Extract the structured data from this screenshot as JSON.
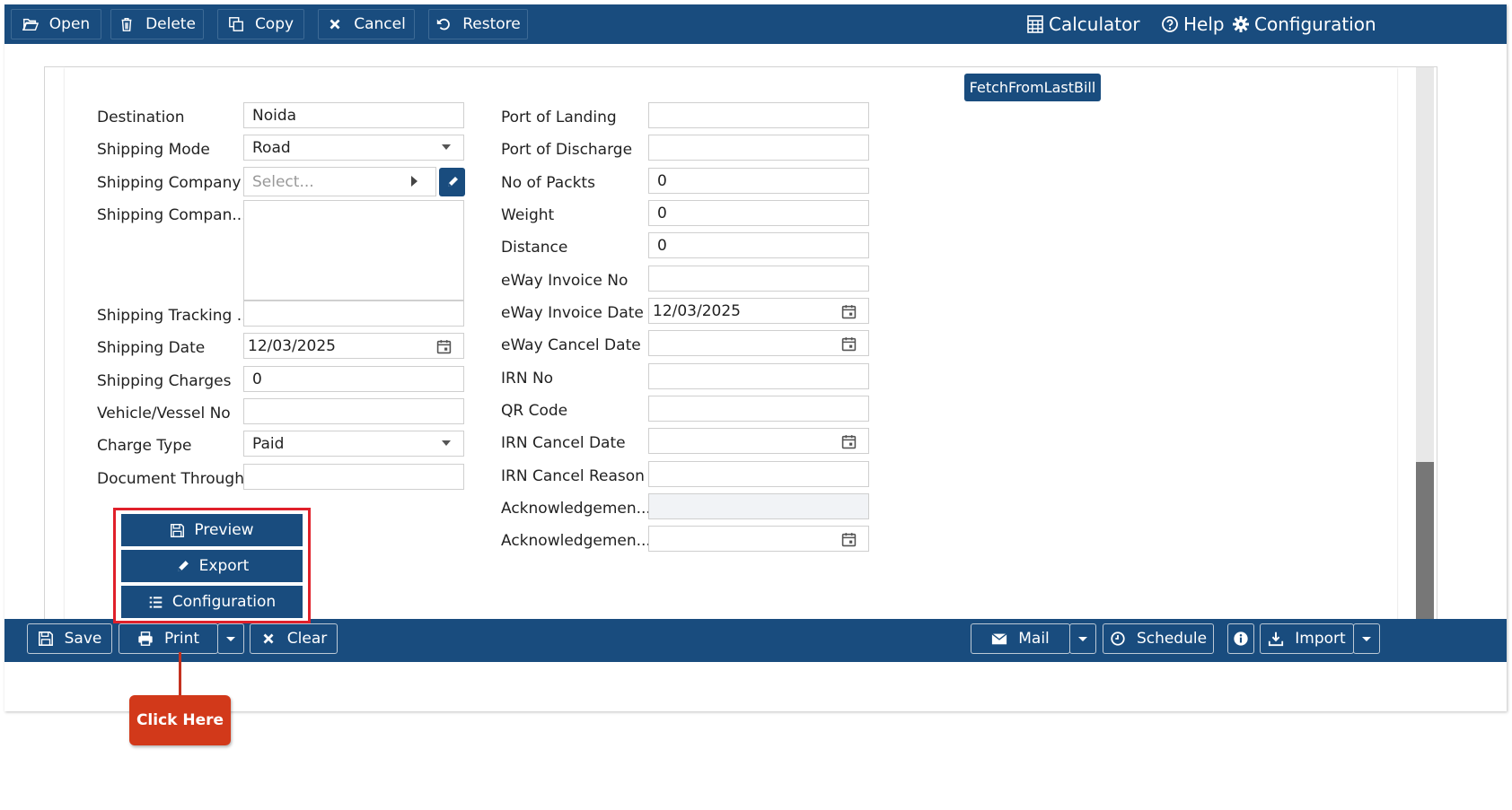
{
  "toolbar": {
    "open": "Open",
    "delete": "Delete",
    "copy": "Copy",
    "cancel": "Cancel",
    "restore": "Restore",
    "calculator": "Calculator",
    "help": "Help",
    "configuration": "Configuration"
  },
  "fetch_button": "FetchFromLastBill",
  "left_fields": {
    "destination": {
      "label": "Destination",
      "value": "Noida"
    },
    "shipping_mode": {
      "label": "Shipping Mode",
      "value": "Road"
    },
    "shipping_company": {
      "label": "Shipping Company",
      "placeholder": "Select..."
    },
    "shipping_company_address": {
      "label": "Shipping Compan...",
      "value": ""
    },
    "shipping_tracking": {
      "label": "Shipping Tracking ...",
      "value": ""
    },
    "shipping_date": {
      "label": "Shipping Date",
      "value": "12/03/2025"
    },
    "shipping_charges": {
      "label": "Shipping Charges",
      "value": "0"
    },
    "vehicle_no": {
      "label": "Vehicle/Vessel No",
      "value": ""
    },
    "charge_type": {
      "label": "Charge Type",
      "value": "Paid"
    },
    "document_through": {
      "label": "Document Through",
      "value": ""
    }
  },
  "right_fields": {
    "port_of_landing": {
      "label": "Port of Landing",
      "value": ""
    },
    "port_of_discharge": {
      "label": "Port of Discharge",
      "value": ""
    },
    "no_of_packts": {
      "label": "No of Packts",
      "value": "0"
    },
    "weight": {
      "label": "Weight",
      "value": "0"
    },
    "distance": {
      "label": "Distance",
      "value": "0"
    },
    "eway_invoice_no": {
      "label": "eWay Invoice No",
      "value": ""
    },
    "eway_invoice_date": {
      "label": "eWay Invoice Date",
      "value": "12/03/2025"
    },
    "eway_cancel_date": {
      "label": "eWay Cancel Date",
      "value": ""
    },
    "irn_no": {
      "label": "IRN No",
      "value": ""
    },
    "qr_code": {
      "label": "QR Code",
      "value": ""
    },
    "irn_cancel_date": {
      "label": "IRN Cancel Date",
      "value": ""
    },
    "irn_cancel_reason": {
      "label": "IRN Cancel Reason",
      "value": ""
    },
    "acknowledgement_no": {
      "label": "Acknowledgemen...",
      "value": ""
    },
    "acknowledgement_date": {
      "label": "Acknowledgemen...",
      "value": ""
    }
  },
  "print_menu": {
    "preview": "Preview",
    "export": "Export",
    "configuration": "Configuration"
  },
  "bottombar": {
    "save": "Save",
    "print": "Print",
    "clear": "Clear",
    "mail": "Mail",
    "schedule": "Schedule",
    "import": "Import"
  },
  "callout": "Click Here",
  "colors": {
    "primary": "#194c7e",
    "highlight": "#e0202a",
    "callout": "#d2391a"
  }
}
